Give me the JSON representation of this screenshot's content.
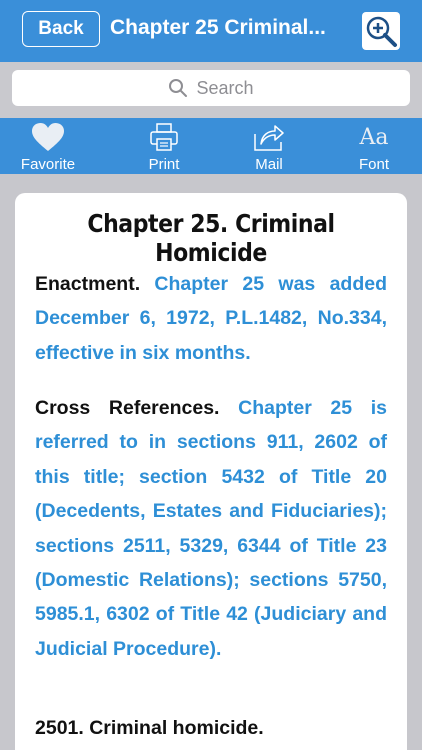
{
  "nav": {
    "back_label": "Back",
    "title": "Chapter 25   Criminal...",
    "zoom_icon": "zoom-in-icon"
  },
  "search": {
    "placeholder": "Search"
  },
  "toolbar": {
    "items": [
      {
        "label": "Favorite",
        "icon": "heart-icon"
      },
      {
        "label": "Print",
        "icon": "printer-icon"
      },
      {
        "label": "Mail",
        "icon": "share-icon"
      },
      {
        "label": "Font",
        "icon": "font-icon"
      }
    ]
  },
  "document": {
    "title": "Chapter 25. Criminal Homicide",
    "enactment": {
      "heading": "Enactment.",
      "text": "Chapter 25 was added December 6, 1972, P.L.1482, No.334, effective in six months."
    },
    "cross_references": {
      "heading": "Cross References.",
      "text": "Chapter 25 is referred to in sections 911, 2602 of this title; section 5432 of Title 20 (Decedents, Estates and Fiduciaries); sections 2511, 5329, 6344 of Title 23 (Domestic Relations); sections 5750, 5985.1, 6302 of Title 42 (Judiciary and Judicial Procedure)."
    },
    "section_heading": "2501. Criminal homicide."
  },
  "colors": {
    "accent": "#3a8fd9",
    "link_text": "#2e8fd6",
    "background": "#c7c7cc"
  }
}
